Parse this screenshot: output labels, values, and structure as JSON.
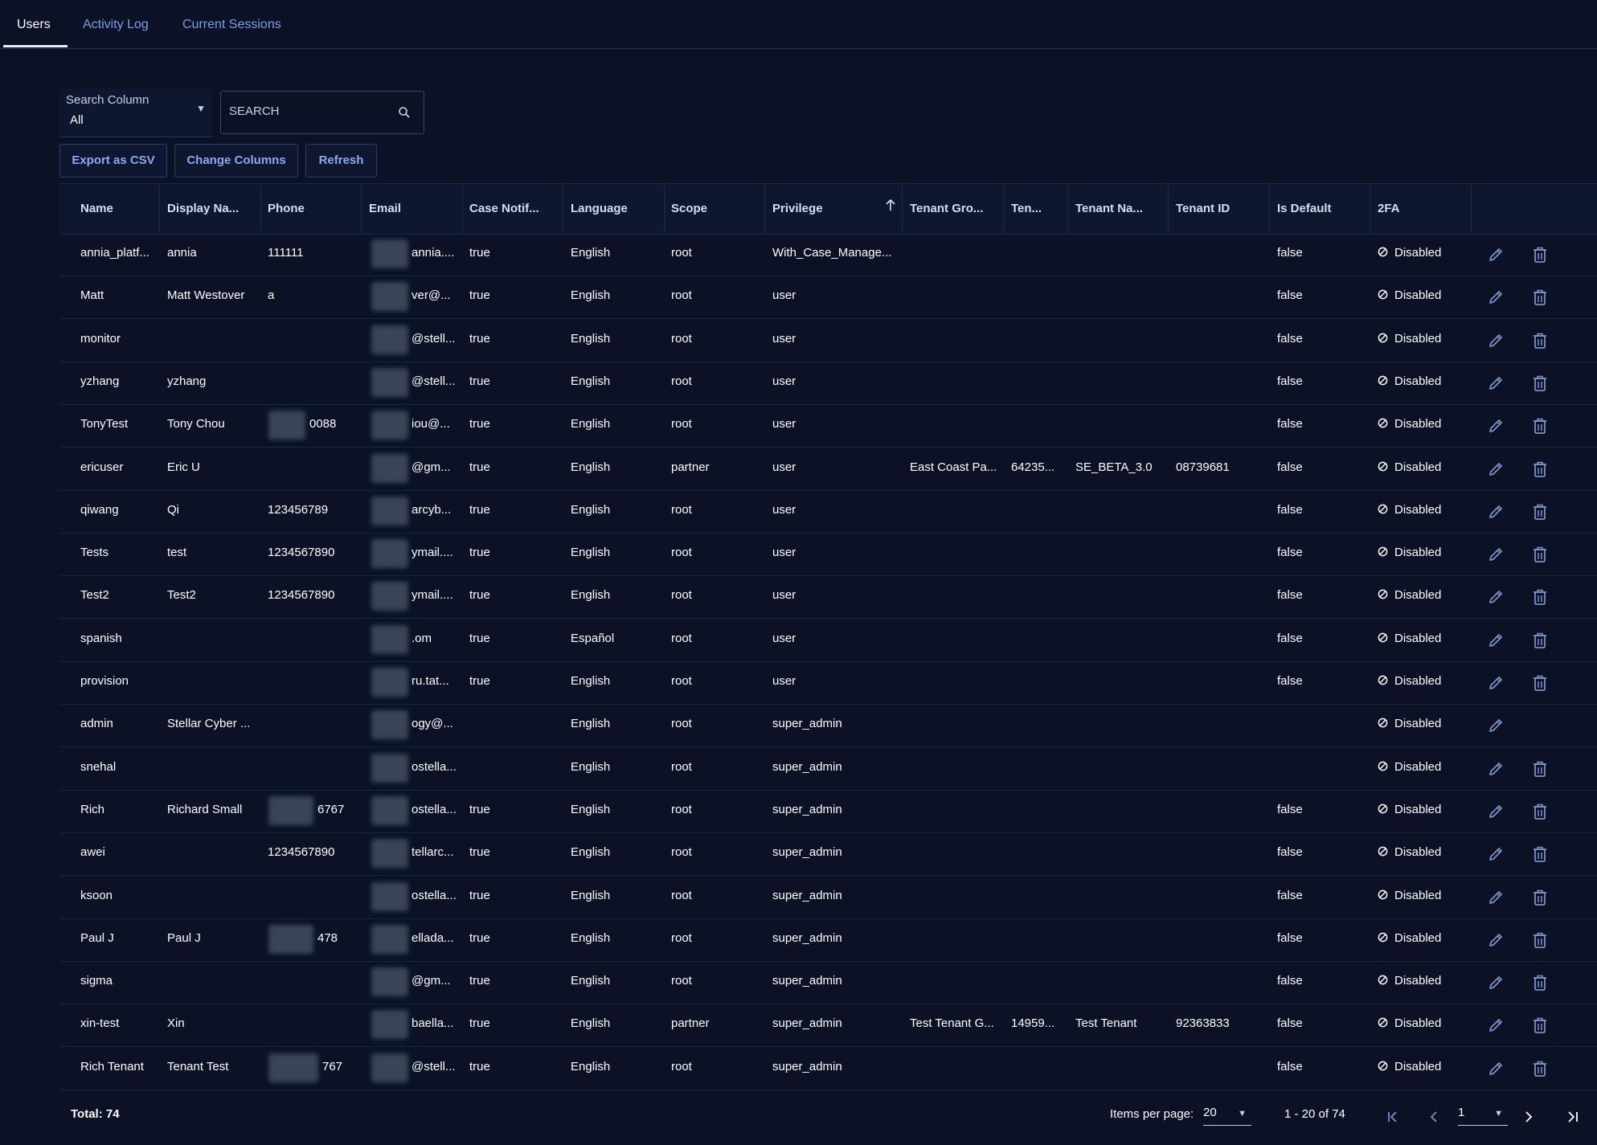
{
  "tabs": [
    {
      "label": "Users",
      "active": true
    },
    {
      "label": "Activity Log",
      "active": false
    },
    {
      "label": "Current Sessions",
      "active": false
    }
  ],
  "search": {
    "column_label": "Search Column",
    "column_value": "All",
    "placeholder": "SEARCH"
  },
  "toolbar": {
    "export_label": "Export as CSV",
    "columns_label": "Change Columns",
    "refresh_label": "Refresh"
  },
  "table": {
    "columns": [
      "Name",
      "Display Na...",
      "Phone",
      "Email",
      "Case Notif...",
      "Language",
      "Scope",
      "Privilege",
      "Tenant Gro...",
      "Ten...",
      "Tenant Na...",
      "Tenant ID",
      "Is Default",
      "2FA"
    ],
    "sorted_column": "Privilege",
    "sort_direction": "ascending",
    "rows": [
      {
        "name": "annia_platf...",
        "display": "annia",
        "phone": "111111",
        "email": "annia....",
        "case": "true",
        "language": "English",
        "scope": "root",
        "privilege": "With_Case_Manage...",
        "tgroup": "",
        "ten": "",
        "tname": "",
        "tid": "",
        "isdefault": "false",
        "tfa": "Disabled",
        "deletable": true
      },
      {
        "name": "Matt",
        "display": "Matt Westover",
        "phone": "a",
        "email": "ver@...",
        "case": "true",
        "language": "English",
        "scope": "root",
        "privilege": "user",
        "tgroup": "",
        "ten": "",
        "tname": "",
        "tid": "",
        "isdefault": "false",
        "tfa": "Disabled",
        "deletable": true
      },
      {
        "name": "monitor",
        "display": "",
        "phone": "",
        "email": "@stell...",
        "case": "true",
        "language": "English",
        "scope": "root",
        "privilege": "user",
        "tgroup": "",
        "ten": "",
        "tname": "",
        "tid": "",
        "isdefault": "false",
        "tfa": "Disabled",
        "deletable": true
      },
      {
        "name": "yzhang",
        "display": "yzhang",
        "phone": "",
        "email": "@stell...",
        "case": "true",
        "language": "English",
        "scope": "root",
        "privilege": "user",
        "tgroup": "",
        "ten": "",
        "tname": "",
        "tid": "",
        "isdefault": "false",
        "tfa": "Disabled",
        "deletable": true
      },
      {
        "name": "TonyTest",
        "display": "Tony Chou",
        "phone": "0088",
        "email": "iou@...",
        "case": "true",
        "language": "English",
        "scope": "root",
        "privilege": "user",
        "tgroup": "",
        "ten": "",
        "tname": "",
        "tid": "",
        "isdefault": "false",
        "tfa": "Disabled",
        "deletable": true
      },
      {
        "name": "ericuser",
        "display": "Eric U",
        "phone": "",
        "email": "@gm...",
        "case": "true",
        "language": "English",
        "scope": "partner",
        "privilege": "user",
        "tgroup": "East Coast Pa...",
        "ten": "64235...",
        "tname": "SE_BETA_3.0",
        "tid": "08739681",
        "isdefault": "false",
        "tfa": "Disabled",
        "deletable": true
      },
      {
        "name": "qiwang",
        "display": "Qi",
        "phone": "123456789",
        "email": "arcyb...",
        "case": "true",
        "language": "English",
        "scope": "root",
        "privilege": "user",
        "tgroup": "",
        "ten": "",
        "tname": "",
        "tid": "",
        "isdefault": "false",
        "tfa": "Disabled",
        "deletable": true
      },
      {
        "name": "Tests",
        "display": "test",
        "phone": "1234567890",
        "email": "ymail....",
        "case": "true",
        "language": "English",
        "scope": "root",
        "privilege": "user",
        "tgroup": "",
        "ten": "",
        "tname": "",
        "tid": "",
        "isdefault": "false",
        "tfa": "Disabled",
        "deletable": true
      },
      {
        "name": "Test2",
        "display": "Test2",
        "phone": "1234567890",
        "email": "ymail....",
        "case": "true",
        "language": "English",
        "scope": "root",
        "privilege": "user",
        "tgroup": "",
        "ten": "",
        "tname": "",
        "tid": "",
        "isdefault": "false",
        "tfa": "Disabled",
        "deletable": true
      },
      {
        "name": "spanish",
        "display": "",
        "phone": "",
        "email": ".om",
        "case": "true",
        "language": "Español",
        "scope": "root",
        "privilege": "user",
        "tgroup": "",
        "ten": "",
        "tname": "",
        "tid": "",
        "isdefault": "false",
        "tfa": "Disabled",
        "deletable": true
      },
      {
        "name": "provision",
        "display": "",
        "phone": "",
        "email": "ru.tat...",
        "case": "true",
        "language": "English",
        "scope": "root",
        "privilege": "user",
        "tgroup": "",
        "ten": "",
        "tname": "",
        "tid": "",
        "isdefault": "false",
        "tfa": "Disabled",
        "deletable": true
      },
      {
        "name": "admin",
        "display": "Stellar Cyber ...",
        "phone": "",
        "email": "ogy@...",
        "case": "",
        "language": "English",
        "scope": "root",
        "privilege": "super_admin",
        "tgroup": "",
        "ten": "",
        "tname": "",
        "tid": "",
        "isdefault": "",
        "tfa": "Disabled",
        "deletable": false
      },
      {
        "name": "snehal",
        "display": "",
        "phone": "",
        "email": "ostella...",
        "case": "",
        "language": "English",
        "scope": "root",
        "privilege": "super_admin",
        "tgroup": "",
        "ten": "",
        "tname": "",
        "tid": "",
        "isdefault": "",
        "tfa": "Disabled",
        "deletable": true
      },
      {
        "name": "Rich",
        "display": "Richard Small",
        "phone": "6767",
        "email": "ostella...",
        "case": "true",
        "language": "English",
        "scope": "root",
        "privilege": "super_admin",
        "tgroup": "",
        "ten": "",
        "tname": "",
        "tid": "",
        "isdefault": "false",
        "tfa": "Disabled",
        "deletable": true
      },
      {
        "name": "awei",
        "display": "",
        "phone": "1234567890",
        "email": "tellarc...",
        "case": "true",
        "language": "English",
        "scope": "root",
        "privilege": "super_admin",
        "tgroup": "",
        "ten": "",
        "tname": "",
        "tid": "",
        "isdefault": "false",
        "tfa": "Disabled",
        "deletable": true
      },
      {
        "name": "ksoon",
        "display": "",
        "phone": "",
        "email": "ostella...",
        "case": "true",
        "language": "English",
        "scope": "root",
        "privilege": "super_admin",
        "tgroup": "",
        "ten": "",
        "tname": "",
        "tid": "",
        "isdefault": "false",
        "tfa": "Disabled",
        "deletable": true
      },
      {
        "name": "Paul J",
        "display": "Paul J",
        "phone": "478",
        "email": "ellada...",
        "case": "true",
        "language": "English",
        "scope": "root",
        "privilege": "super_admin",
        "tgroup": "",
        "ten": "",
        "tname": "",
        "tid": "",
        "isdefault": "false",
        "tfa": "Disabled",
        "deletable": true
      },
      {
        "name": "sigma",
        "display": "",
        "phone": "",
        "email": "@gm...",
        "case": "true",
        "language": "English",
        "scope": "root",
        "privilege": "super_admin",
        "tgroup": "",
        "ten": "",
        "tname": "",
        "tid": "",
        "isdefault": "false",
        "tfa": "Disabled",
        "deletable": true
      },
      {
        "name": "xin-test",
        "display": "Xin",
        "phone": "",
        "email": "baella...",
        "case": "true",
        "language": "English",
        "scope": "partner",
        "privilege": "super_admin",
        "tgroup": "Test Tenant G...",
        "ten": "14959...",
        "tname": "Test Tenant",
        "tid": "92363833",
        "isdefault": "false",
        "tfa": "Disabled",
        "deletable": true
      },
      {
        "name": "Rich Tenant",
        "display": "Tenant Test",
        "phone": "767",
        "email": "@stell...",
        "case": "true",
        "language": "English",
        "scope": "root",
        "privilege": "super_admin",
        "tgroup": "",
        "ten": "",
        "tname": "",
        "tid": "",
        "isdefault": "false",
        "tfa": "Disabled",
        "deletable": true
      }
    ]
  },
  "footer": {
    "total": "Total: 74",
    "items_per_page_label": "Items per page:",
    "items_per_page": "20",
    "range": "1 - 20 of 74",
    "page": "1"
  },
  "colors": {
    "background": "#0b1226",
    "header_bg": "#0e1630",
    "accent": "#7e9ce8",
    "icon": "#7e8fc8"
  },
  "icons": [
    "search-icon",
    "sort-ascending-icon",
    "ban-icon",
    "edit-icon",
    "trash-icon",
    "first-page-icon",
    "prev-page-icon",
    "next-page-icon",
    "last-page-icon"
  ]
}
